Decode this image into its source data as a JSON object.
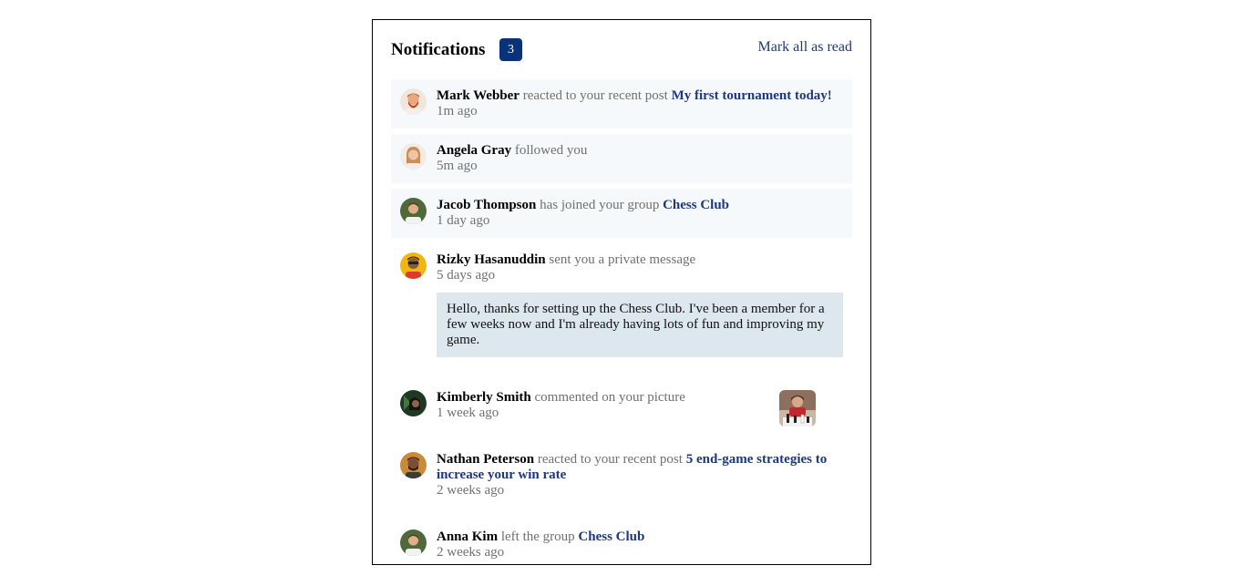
{
  "header": {
    "title": "Notifications",
    "count": "3",
    "mark_all": "Mark all as read"
  },
  "notifications": [
    {
      "user": "Mark Webber",
      "action": "reacted to your recent post",
      "target": "My first tournament today!",
      "time": "1m ago",
      "unread": true,
      "avatar_icon": "avatar-mark-webber"
    },
    {
      "user": "Angela Gray",
      "action": "followed you",
      "target": "",
      "time": "5m ago",
      "unread": true,
      "avatar_icon": "avatar-angela-gray"
    },
    {
      "user": "Jacob Thompson",
      "action": "has joined your group",
      "target": "Chess Club",
      "time": "1 day ago",
      "unread": true,
      "avatar_icon": "avatar-jacob-thompson"
    },
    {
      "user": "Rizky Hasanuddin",
      "action": "sent you a private message",
      "target": "",
      "time": "5 days ago",
      "unread": false,
      "message": "Hello, thanks for setting up the Chess Club. I've been a member for a few weeks now and I'm already having lots of fun and improving my game.",
      "avatar_icon": "avatar-rizky-hasanuddin"
    },
    {
      "user": "Kimberly Smith",
      "action": "commented on your picture",
      "target": "",
      "time": "1 week ago",
      "unread": false,
      "picture_icon": "chess-picture",
      "avatar_icon": "avatar-kimberly-smith"
    },
    {
      "user": "Nathan Peterson",
      "action": "reacted to your recent post",
      "target": "5 end-game strategies to increase your win rate",
      "time": "2 weeks ago",
      "unread": false,
      "avatar_icon": "avatar-nathan-peterson"
    },
    {
      "user": "Anna Kim",
      "action": "left the group",
      "target": "Chess Club",
      "time": "2 weeks ago",
      "unread": false,
      "avatar_icon": "avatar-anna-kim"
    }
  ],
  "colors": {
    "badge_bg": "#0a327b",
    "link": "#1c3a7a",
    "unread_bg": "#f6f9fb",
    "message_bg": "#dde7ee",
    "muted_text": "#707070"
  }
}
